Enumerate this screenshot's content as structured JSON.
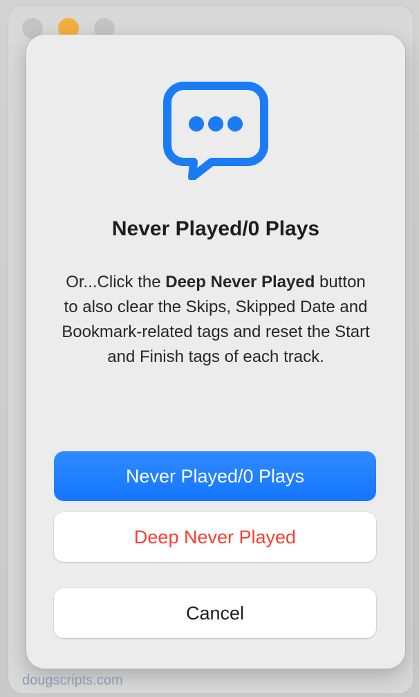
{
  "dialog": {
    "icon": "speech-bubble-ellipsis-icon",
    "title": "Never Played/0 Plays",
    "message": {
      "prefix": "Or...Click the ",
      "emphasis": "Deep Never Played",
      "suffix": " button to also clear the Skips, Skipped Date and Bookmark-related tags and reset the Start and Finish tags of each track."
    },
    "buttons": {
      "primary_label": "Never Played/0 Plays",
      "deep_label": "Deep Never Played",
      "cancel_label": "Cancel"
    }
  },
  "watermark": "dougscripts.com",
  "colors": {
    "accent": "#1476ff",
    "destructive": "#ff3b30",
    "icon": "#1a7cf5"
  }
}
